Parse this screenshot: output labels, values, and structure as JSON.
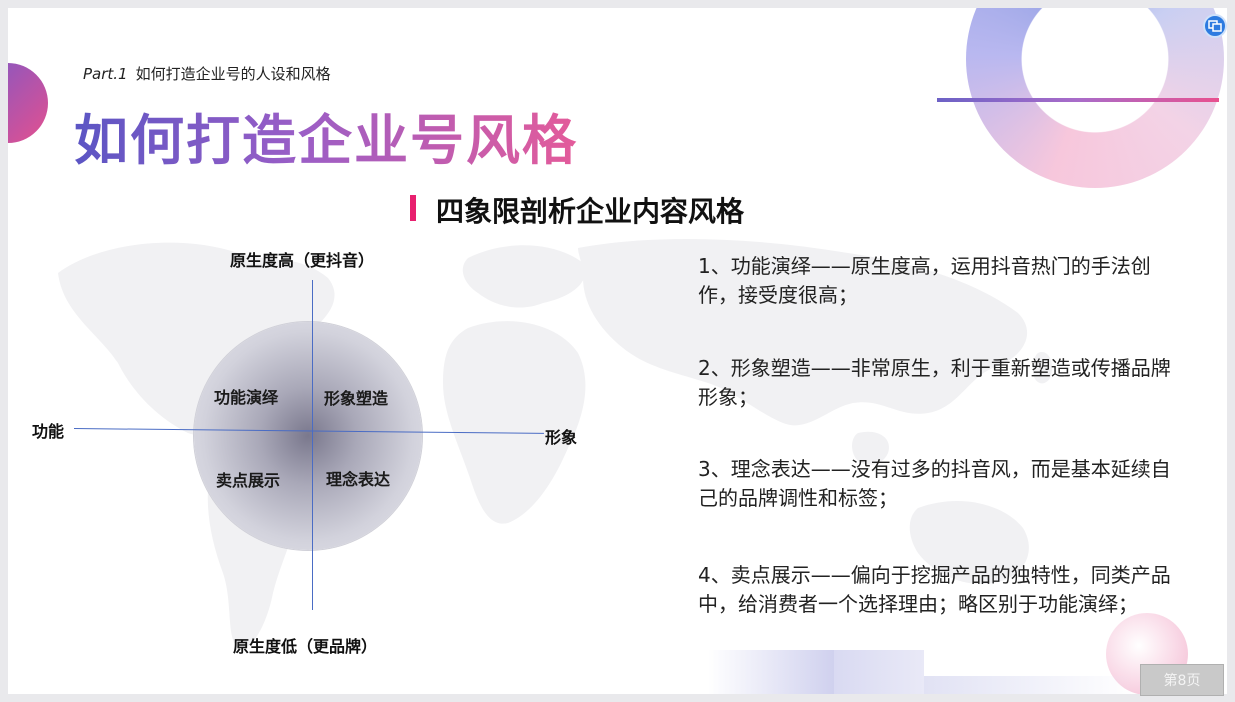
{
  "header": {
    "part_prefix": "Part.1",
    "part_title": "如何打造企业号的人设和风格",
    "main_title": "如何打造企业号风格"
  },
  "section": {
    "subtitle": "四象限剖析企业内容风格"
  },
  "quadrant": {
    "axis_top": "原生度高（更抖音）",
    "axis_bottom": "原生度低（更品牌）",
    "axis_left": "功能",
    "axis_right": "形象",
    "top_left": "功能演绎",
    "top_right": "形象塑造",
    "bottom_left": "卖点展示",
    "bottom_right": "理念表达"
  },
  "descriptions": [
    "1、功能演绎——原生度高，运用抖音热门的手法创作，接受度很高；",
    "2、形象塑造——非常原生，利于重新塑造或传播品牌形象；",
    "3、理念表达——没有过多的抖音风，而是基本延续自己的品牌调性和标签；",
    "4、卖点展示——偏向于挖掘产品的独特性，同类产品中，给消费者一个选择理由；略区别于功能演绎；"
  ],
  "page_button": "第8页",
  "icons": {
    "corner": "window-switch-icon"
  },
  "colors": {
    "accent_pink": "#e8206f",
    "axis_blue": "#4a6cc4",
    "title_gradient_start": "#5b55c4",
    "title_gradient_end": "#e45b9a"
  }
}
